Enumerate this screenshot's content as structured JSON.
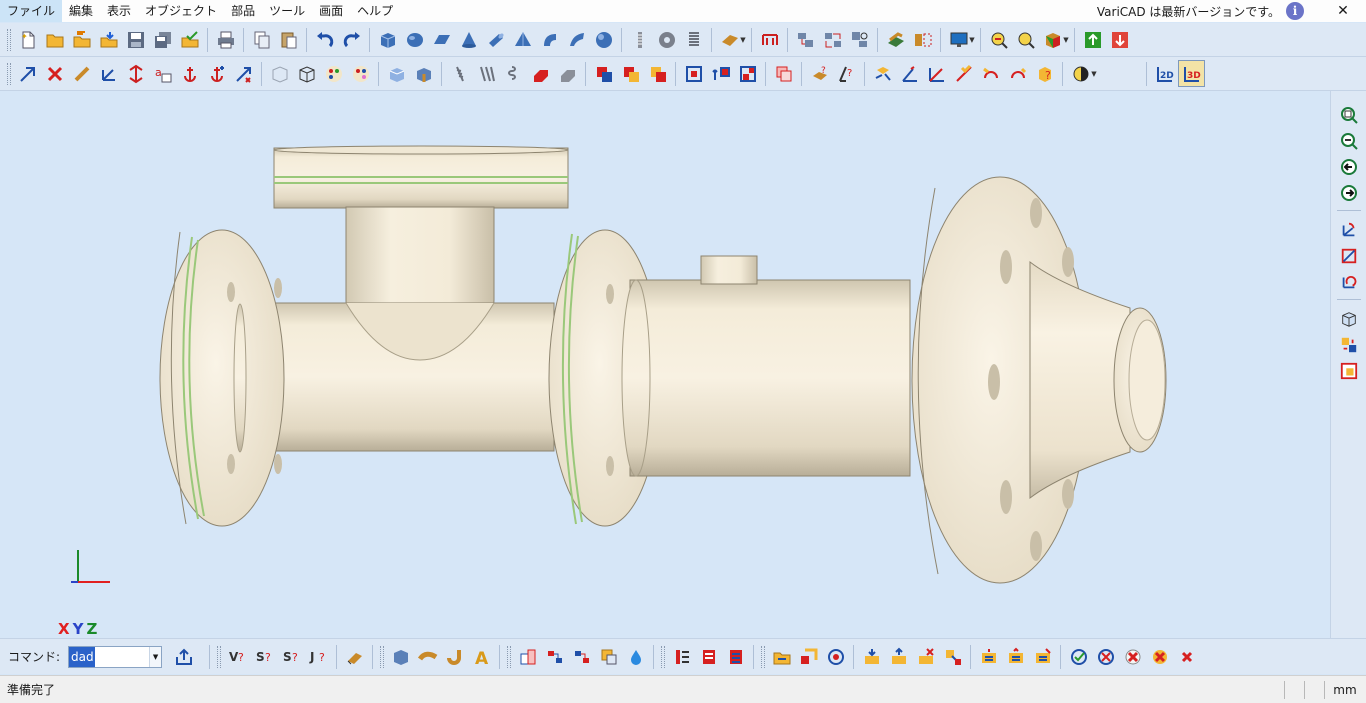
{
  "menu": {
    "items": [
      "ファイル",
      "編集",
      "表示",
      "オブジェクト",
      "部品",
      "ツール",
      "画面",
      "ヘルプ"
    ]
  },
  "update_notice": {
    "text": "VariCAD は最新バージョンです。",
    "icon": "info-icon"
  },
  "window_controls": {
    "close": "✕"
  },
  "command": {
    "label": "コマンド:",
    "value": "dad"
  },
  "axes": {
    "x": "X",
    "y": "Y",
    "z": "Z"
  },
  "status": {
    "text": "準備完了",
    "unit": "mm"
  },
  "toolbar2": {
    "mode_2d": "2D",
    "mode_3d": "3D"
  },
  "icons": {
    "toolbar1": [
      "new-file-icon",
      "open-folder-icon",
      "open-recent-icon",
      "import-icon",
      "save-icon",
      "save-all-icon",
      "export-icon",
      "print-icon",
      "copy-icon",
      "paste-icon",
      "undo-icon",
      "redo-icon",
      "box-solid-icon",
      "cylinder-solid-icon",
      "prism-solid-icon",
      "cone-solid-icon",
      "tube-solid-icon",
      "pyramid-solid-icon",
      "torus-solid-icon",
      "sweep-solid-icon",
      "sphere-solid-icon",
      "bolt-icon",
      "gear-icon",
      "spring-icon",
      "material-icon",
      "dimension-icon",
      "assembly-icon",
      "group-icon",
      "object-tree-icon",
      "move-icon",
      "mirror-icon",
      "monitor-icon",
      "zoom-window-icon",
      "zoom-icon",
      "view-cube-icon",
      "export-up-icon",
      "import-down-icon"
    ],
    "toolbar2": [
      "select-icon",
      "delete-icon",
      "transform-icon",
      "move-axis-icon",
      "stretch-icon",
      "text-icon",
      "anchor-icon",
      "anchor-add-icon",
      "dimension-edit-icon",
      "wireframe-icon",
      "shaded-box-icon",
      "color-palette-icon",
      "color-edit-icon",
      "section-icon",
      "hide-icon",
      "thread-icon",
      "threads-icon",
      "spring-tool-icon",
      "paint-red-icon",
      "fill-gray-icon",
      "boolean-add-icon",
      "boolean-subtract-icon",
      "boolean-intersect-icon",
      "cut-icon",
      "copy-solid-icon",
      "split-icon",
      "layer-icon",
      "measure-icon",
      "measure-dist-icon",
      "check-icon",
      "angle-icon",
      "axis-icon",
      "diagonal-icon",
      "arc-icon",
      "mass-icon",
      "query-icon",
      "balance-icon"
    ],
    "right": [
      "zoom-all-icon",
      "zoom-extents-icon",
      "pan-left-icon",
      "pan-right-icon",
      "rotate-x-icon",
      "rotate-y-icon",
      "rotate-z-icon",
      "view-iso-icon",
      "view-color-icon",
      "view-wire-icon"
    ],
    "cmdbar": [
      "upload-icon",
      "query-v-icon",
      "query-s-icon",
      "query-s2-icon",
      "query-j-icon",
      "eraser-icon",
      "box-blue-icon",
      "bend-icon",
      "pipe-icon",
      "text-a-icon",
      "bom-icon",
      "link-icon",
      "link-blue-icon",
      "copy-yellow-icon",
      "drop-icon",
      "attr-icon",
      "attr-red-icon",
      "attr-list-icon",
      "open-part-icon",
      "insert-part-icon",
      "rotate-part-icon",
      "update-icon",
      "update-up-icon",
      "remove-icon",
      "replace-icon",
      "sheet-icon",
      "sheet-up-icon",
      "sheet-edit-icon",
      "check-ok-icon",
      "cancel-1-icon",
      "cancel-2-icon",
      "cancel-3-icon",
      "cancel-4-icon"
    ]
  }
}
